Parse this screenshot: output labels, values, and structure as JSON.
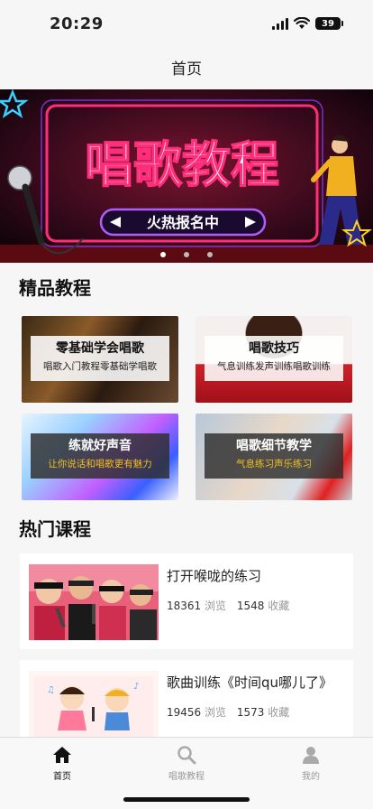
{
  "status": {
    "time": "20:29",
    "battery": "39"
  },
  "nav": {
    "title": "首页"
  },
  "banner": {
    "headline": "唱歌教程",
    "cta": "火热报名中"
  },
  "featured": {
    "title": "精品教程",
    "cards": [
      {
        "title": "零基础学会唱歌",
        "subtitle": "唱歌入门教程零基础学唱歌"
      },
      {
        "title": "唱歌技巧",
        "subtitle": "气息训练发声训练唱歌训练"
      },
      {
        "title": "练就好声音",
        "subtitle": "让你说话和唱歌更有魅力"
      },
      {
        "title": "唱歌细节教学",
        "subtitle": "气息练习声乐练习"
      }
    ]
  },
  "hot": {
    "title": "热门课程",
    "courses": [
      {
        "title": "打开喉咙的练习",
        "views": "18361",
        "views_label": "浏览",
        "favs": "1548",
        "favs_label": "收藏"
      },
      {
        "title": "歌曲训练《时间qu哪儿了》",
        "views": "19456",
        "views_label": "浏览",
        "favs": "1573",
        "favs_label": "收藏"
      }
    ]
  },
  "tabbar": {
    "home": "首页",
    "tutorial": "唱歌教程",
    "mine": "我的"
  },
  "colors": {
    "accent_yellow": "#f0c020",
    "neon_pink": "#ff2d7a",
    "neon_purple": "#8a3cff"
  }
}
